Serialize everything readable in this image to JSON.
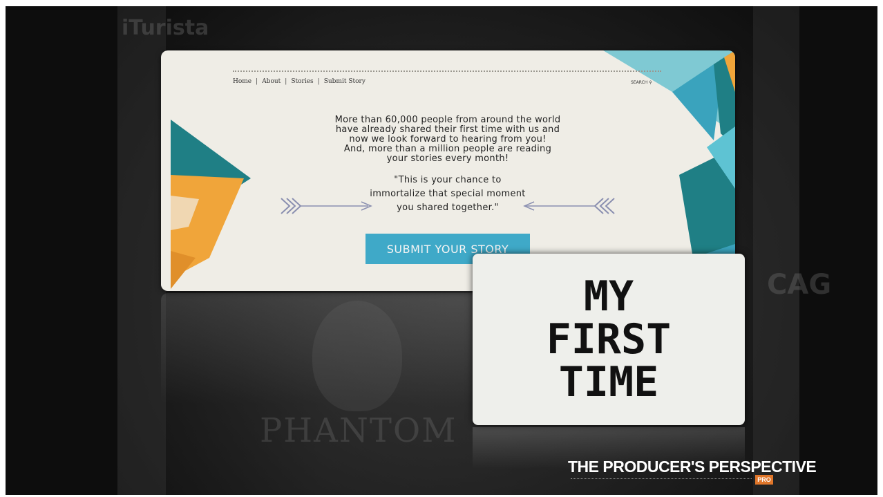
{
  "website": {
    "nav": [
      "Home",
      "About",
      "Stories",
      "Submit Story"
    ],
    "nav_separator": "|",
    "search_label": "SEARCH",
    "intro_lines": [
      "More than 60,000 people from around the world",
      "have already shared their first time with us and",
      "now we look forward to hearing from you!",
      "And, more than a million people are reading",
      "your stories every month!"
    ],
    "quote_lines": [
      "\"This is your chance to",
      "immortalize that special moment",
      "you shared together.\""
    ],
    "submit_button_label": "SUBMIT YOUR STORY",
    "colors": {
      "teal": "#1f7f85",
      "light_teal": "#5ec3d3",
      "orange": "#f0a53a",
      "button": "#3fa9c8"
    }
  },
  "background": {
    "sign_text_top": "iTurista",
    "sign_text_bottom": "PHANTOM",
    "sign_text_right": "CAG"
  },
  "title_card": {
    "title": "MY\nFIRST\nTIME"
  },
  "branding": {
    "name": "THE PRODUCER'S PERSPECTIVE",
    "badge": "PRO"
  }
}
